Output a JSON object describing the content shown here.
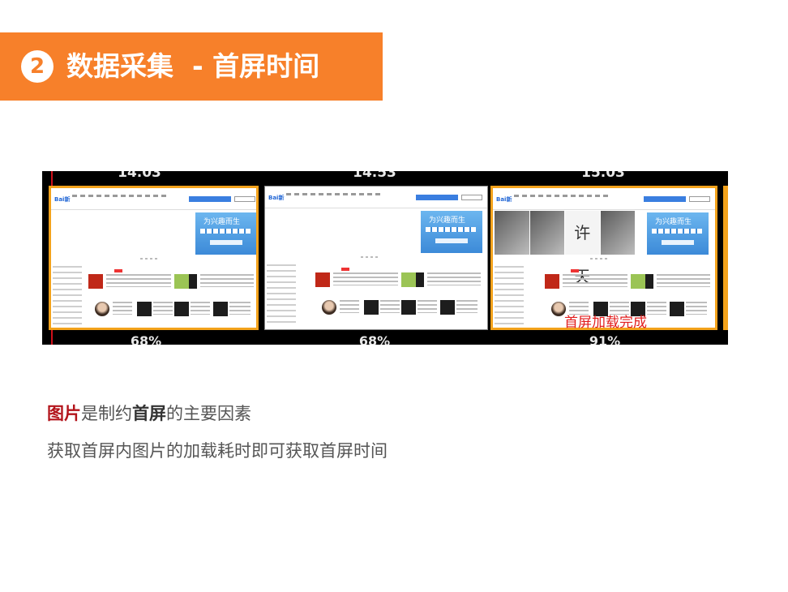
{
  "header": {
    "step_number": "2",
    "title": "数据采集  - 首屏时间"
  },
  "filmstrip": {
    "frames": [
      {
        "timestamp": "14.03",
        "percent": "68%"
      },
      {
        "timestamp": "14.53",
        "percent": "68%"
      },
      {
        "timestamp": "15.03",
        "percent": "91%"
      }
    ],
    "hero_text": "为兴趣而生",
    "signature_text": "许 天",
    "annotation": "首屏加载完成"
  },
  "body": {
    "line1_red": "图片",
    "line1_a": "是制约",
    "line1_bold": "首屏",
    "line1_b": "的主要因素",
    "line2": "获取首屏内图片的加载耗时即可获取首屏时间"
  },
  "colors": {
    "accent": "#f7802a",
    "frame_border": "#f3a21b",
    "highlight_red": "#b3141b",
    "annotation_red": "#e21e1e"
  }
}
